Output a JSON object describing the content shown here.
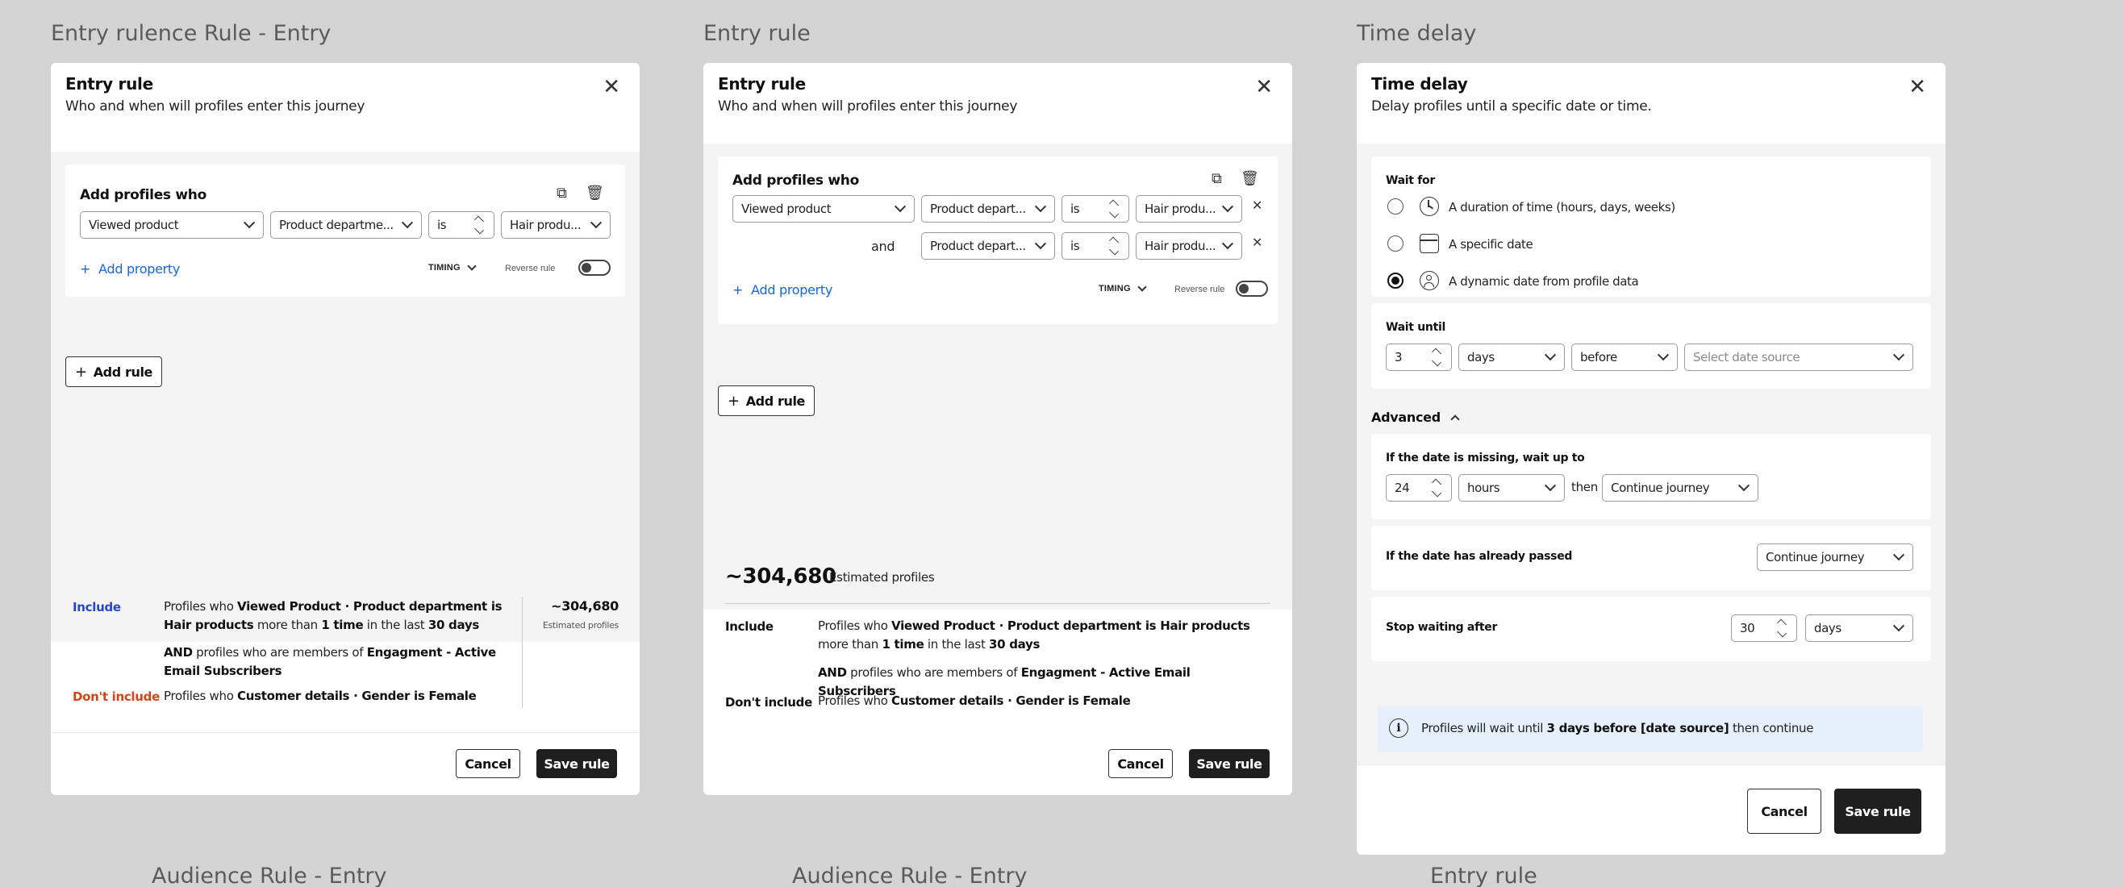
{
  "frame_labels": {
    "a": "Entry rulence Rule - Entry",
    "b": "Entry rule",
    "c": "Time delay",
    "bottom_a": "Audience Rule - Entry",
    "bottom_b": "Audience Rule - Entry",
    "bottom_c": "Entry rule"
  },
  "panel_a": {
    "title": "Entry rule",
    "subtitle": "Who and when will profiles enter this journey",
    "card_title": "Add profiles who",
    "row": {
      "event": "Viewed product",
      "property": "Product departme...",
      "op": "is",
      "value": "Hair produ..."
    },
    "add_property": "Add property",
    "timing": "TIMING",
    "reverse": "Reverse rule",
    "add_rule": "Add rule",
    "include_label": "Include",
    "include_pre": "Profiles who ",
    "include_b1": "Viewed Product · Product department is Hair products",
    "include_mid": " more than ",
    "include_b2": "1 time",
    "include_mid2": " in the last ",
    "include_b3": "30 days",
    "and_b": "AND",
    "and_mid": " profiles who are members of ",
    "and_b2": "Engagment - Active Email Subscribers",
    "exclude_label": "Don't include",
    "exclude_pre": "Profiles who ",
    "exclude_b": "Customer details · Gender is Female",
    "estimate": "~304,680",
    "estimate_label": "Estimated profiles",
    "cancel": "Cancel",
    "save": "Save rule"
  },
  "panel_b": {
    "title": "Entry rule",
    "subtitle": "Who and when will profiles enter this journey",
    "card_title": "Add profiles who",
    "row1": {
      "event": "Viewed product",
      "property": "Product depart...",
      "op": "is",
      "value": "Hair produ..."
    },
    "and_word": "and",
    "row2": {
      "property": "Product depart...",
      "op": "is",
      "value": "Hair produ..."
    },
    "add_property": "Add property",
    "timing": "TIMING",
    "reverse": "Reverse rule",
    "add_rule": "Add rule",
    "estimate": "~304,680",
    "estimate_label": "Estimated profiles",
    "include_label": "Include",
    "include_pre": "Profiles who ",
    "include_b1": "Viewed Product · Product department is Hair products",
    "include_mid": " more than ",
    "include_b2": "1 time",
    "include_mid2": " in the last ",
    "include_b3": "30 days",
    "and_b": "AND",
    "and_mid": " profiles who are members of ",
    "and_b2": "Engagment - Active Email Subscribers",
    "exclude_label": "Don't include",
    "exclude_pre": "Profiles who ",
    "exclude_b": "Customer details · Gender is Female",
    "cancel": "Cancel",
    "save": "Save rule"
  },
  "panel_c": {
    "title": "Time delay",
    "subtitle": "Delay profiles until a specific date or time.",
    "wait_for": "Wait for",
    "opt1": "A duration of time (hours, days, weeks)",
    "opt2": "A specific date",
    "opt3": "A dynamic date from profile data",
    "wait_until": "Wait until",
    "wu_num": "3",
    "wu_unit": "days",
    "wu_rel": "before",
    "wu_source_placeholder": "Select date source",
    "advanced": "Advanced",
    "missing_label": "If the date is missing, wait up to",
    "missing_num": "24",
    "missing_unit": "hours",
    "then": "then",
    "missing_action": "Continue journey",
    "passed_label": "If the date has already passed",
    "passed_action": "Continue journey",
    "stop_label": "Stop waiting after",
    "stop_num": "30",
    "stop_unit": "days",
    "info_pre": "Profiles will wait until ",
    "info_b": "3 days  before [date source]",
    "info_post": " then continue",
    "cancel": "Cancel",
    "save": "Save rule"
  },
  "colors": {
    "include": "#2b45c9",
    "exclude": "#d0461a",
    "info_bg": "#e5f0fc",
    "primary": "#1f1f1f"
  }
}
